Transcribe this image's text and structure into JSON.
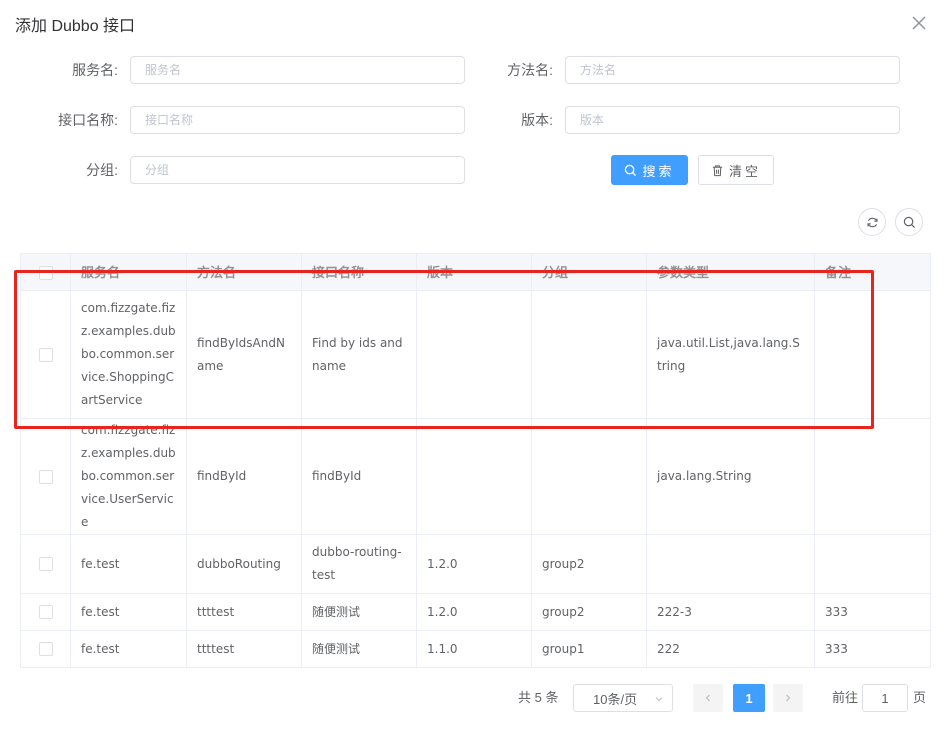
{
  "dialog": {
    "title": "添加 Dubbo 接口"
  },
  "form": {
    "service_label": "服务名:",
    "service_placeholder": "服务名",
    "method_label": "方法名:",
    "method_placeholder": "方法名",
    "api_name_label": "接口名称:",
    "api_name_placeholder": "接口名称",
    "version_label": "版本:",
    "version_placeholder": "版本",
    "group_label": "分组:",
    "group_placeholder": "分组",
    "search_label": "搜索",
    "clear_label": "清空"
  },
  "table": {
    "columns": [
      "服务名",
      "方法名",
      "接口名称",
      "版本",
      "分组",
      "参数类型",
      "备注"
    ],
    "rows": [
      {
        "service": "com.fizzgate.fizz.examples.dubbo.common.service.ShoppingCartService",
        "method": "findByIdsAndName",
        "api_name": "Find by ids and name",
        "version": "",
        "group": "",
        "param_types": "java.util.List,java.lang.String",
        "remark": ""
      },
      {
        "service": "com.fizzgate.fizz.examples.dubbo.common.service.UserService",
        "method": "findById",
        "api_name": "findById",
        "version": "",
        "group": "",
        "param_types": "java.lang.String",
        "remark": ""
      },
      {
        "service": "fe.test",
        "method": "dubboRouting",
        "api_name": "dubbo-routing-test",
        "version": "1.2.0",
        "group": "group2",
        "param_types": "",
        "remark": ""
      },
      {
        "service": "fe.test",
        "method": "ttttest",
        "api_name": "随便测试",
        "version": "1.2.0",
        "group": "group2",
        "param_types": "222-3",
        "remark": "333"
      },
      {
        "service": "fe.test",
        "method": "ttttest",
        "api_name": "随便测试",
        "version": "1.1.0",
        "group": "group1",
        "param_types": "222",
        "remark": "333"
      }
    ]
  },
  "pagination": {
    "total_text": "共 5 条",
    "page_size": "10条/页",
    "current_page": "1",
    "goto_label": "前往",
    "goto_value": "1",
    "page_suffix": "页"
  },
  "colors": {
    "primary": "#409eff",
    "highlight": "#e8241d"
  }
}
